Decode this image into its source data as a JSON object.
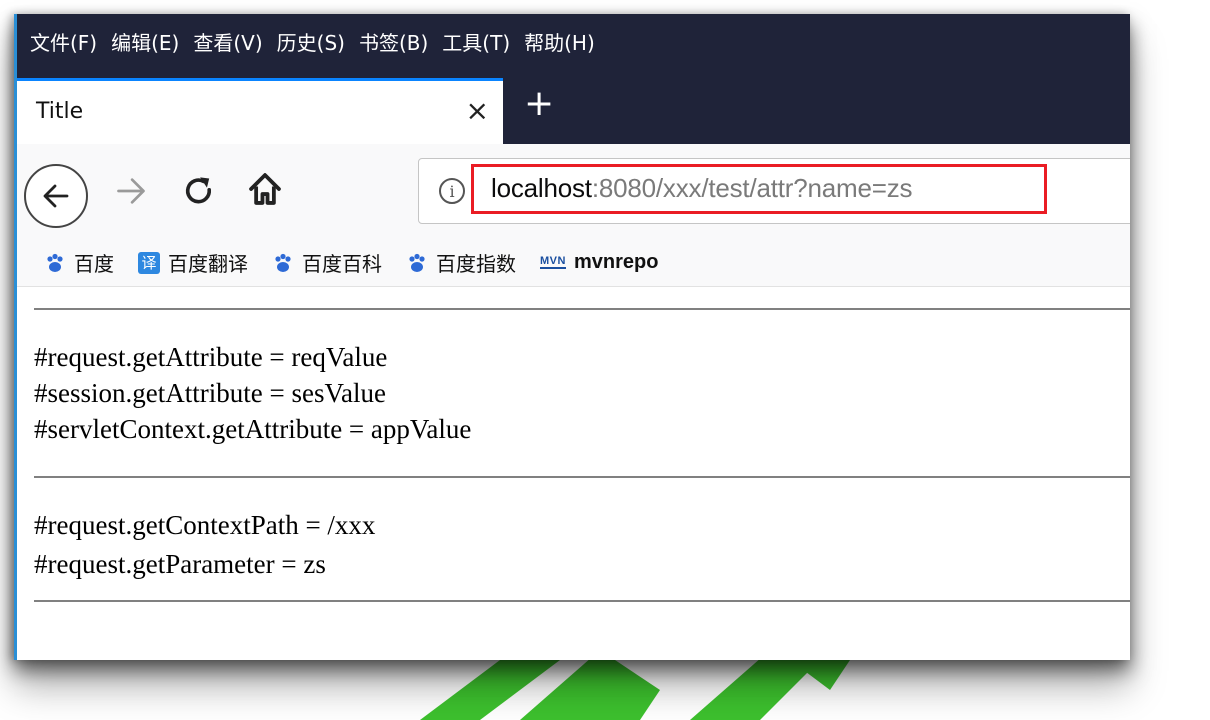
{
  "menu": [
    "文件(F)",
    "编辑(E)",
    "查看(V)",
    "历史(S)",
    "书签(B)",
    "工具(T)",
    "帮助(H)"
  ],
  "tab": {
    "title": "Title",
    "close": "×",
    "new_tab": "+"
  },
  "nav": {
    "url_host": "localhost",
    "url_path": ":8080/xxx/test/attr?name=zs"
  },
  "bookmarks": [
    "百度",
    "百度翻译",
    "百度百科",
    "百度指数",
    "mvnrepo"
  ],
  "bookmark_icon_labels": {
    "translate": "译",
    "mvn": "MVN"
  },
  "content": {
    "attributes": [
      "#request.getAttribute = reqValue",
      "#session.getAttribute = sesValue",
      "#servletContext.getAttribute = appValue"
    ],
    "request_info": [
      "#request.getContextPath = /xxx",
      "#request.getParameter = zs"
    ]
  },
  "colors": {
    "menubar_bg": "#1f2339",
    "tab_accent": "#0a84ff",
    "url_highlight": "#ea1c24",
    "watermark": "#3dc12e"
  }
}
